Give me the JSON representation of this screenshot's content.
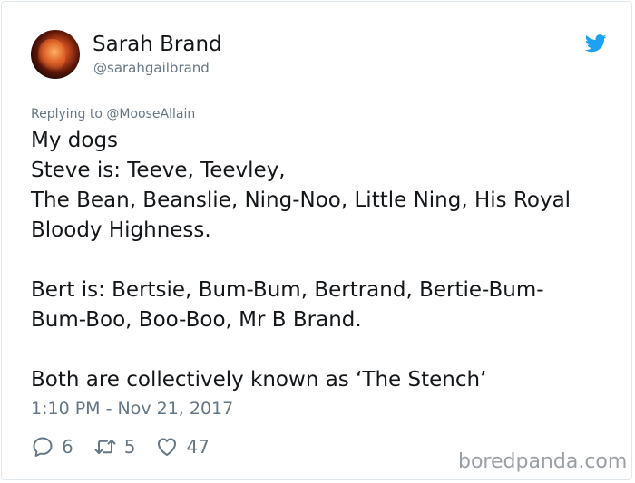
{
  "author": {
    "name": "Sarah Brand",
    "handle": "@sarahgailbrand",
    "avatar_icon": "profile-photo"
  },
  "platform_icon": "twitter-bird-icon",
  "reply": {
    "prefix": "Replying to",
    "mention": "@MooseAllain"
  },
  "tweet": {
    "lines": [
      "My dogs",
      "Steve is: Teeve, Teevley,",
      "The Bean, Beanslie, Ning-Noo, Little Ning, His Royal",
      "Bloody Highness.",
      "",
      "Bert is: Bertsie, Bum-Bum, Bertrand, Bertie-Bum-",
      "Bum-Boo, Boo-Boo, Mr B Brand.",
      "",
      "Both are collectively known as ‘The Stench’"
    ]
  },
  "timestamp": "1:10 PM - Nov 21, 2017",
  "actions": {
    "replies": "6",
    "retweets": "5",
    "likes": "47"
  },
  "watermark": "boredpanda.com",
  "colors": {
    "text": "#14171a",
    "secondary": "#657786",
    "twitter_blue": "#1da1f2",
    "border": "#e1e8ed"
  }
}
